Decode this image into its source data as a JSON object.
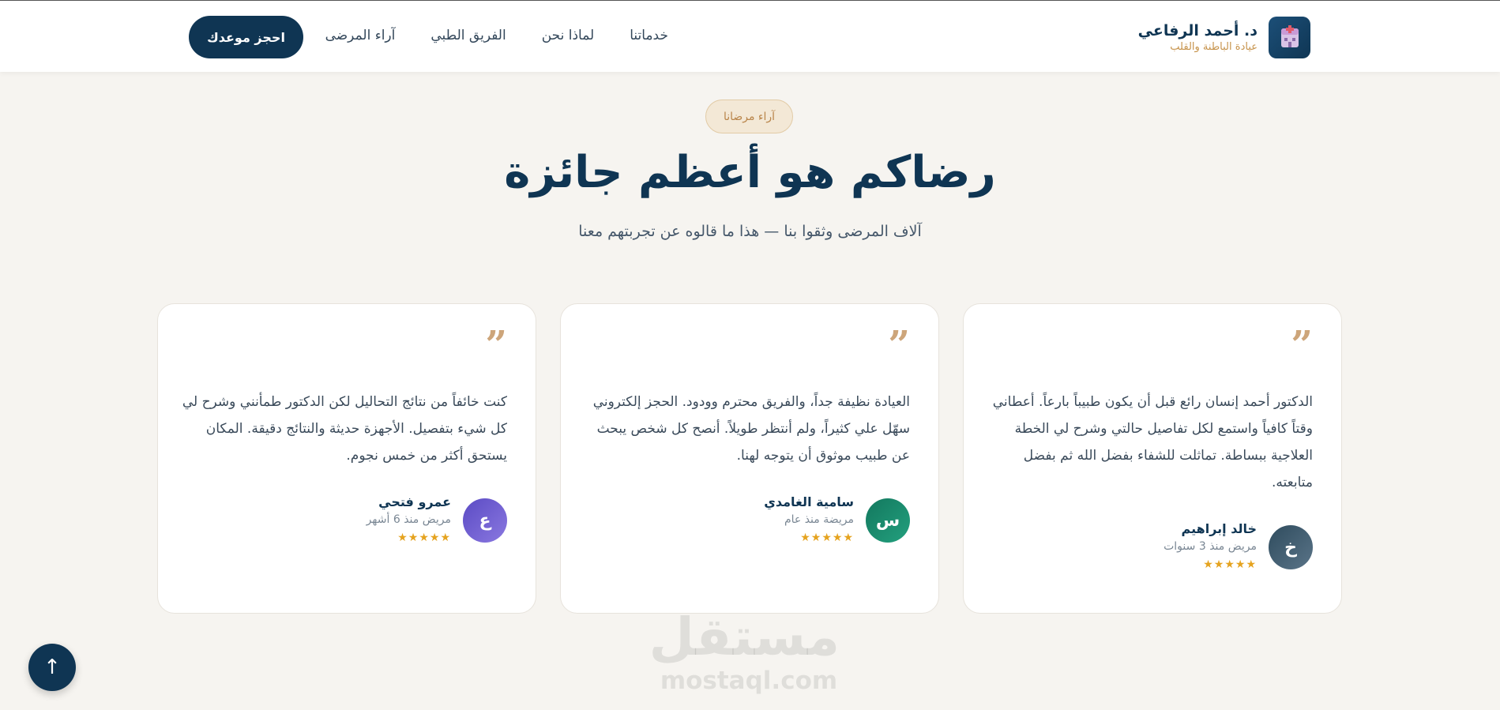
{
  "header": {
    "brand_name": "د. أحمد الرفاعي",
    "brand_subtitle": "عيادة الباطنة والقلب",
    "nav": [
      "خدماتنا",
      "لماذا نحن",
      "الفريق الطبي",
      "آراء المرضى"
    ],
    "cta_label": "احجز موعدك"
  },
  "section": {
    "badge": "آراء مرضانا",
    "title": "رضاكم هو أعظم جائزة",
    "subtitle": "آلاف المرضى وثقوا بنا — هذا ما قالوه عن تجربتهم معنا"
  },
  "testimonials": [
    {
      "quote_mark": "”",
      "text": "الدكتور أحمد إنسان رائع قبل أن يكون طبيباً بارعاً. أعطاني وقتاً كافياً واستمع لكل تفاصيل حالتي وشرح لي الخطة العلاجية ببساطة. تماثلت للشفاء بفضل الله ثم بفضل متابعته.",
      "avatar_letter": "خ",
      "name": "خالد إبراهيم",
      "meta": "مريض منذ 3 سنوات",
      "stars": "★★★★★",
      "rating": 5,
      "avatar_color": "#3e5a6c"
    },
    {
      "quote_mark": "”",
      "text": "العيادة نظيفة جداً، والفريق محترم وودود. الحجز إلكتروني سهّل علي كثيراً، ولم أنتظر طويلاً. أنصح كل شخص يبحث عن طبيب موثوق أن يتوجه لهنا.",
      "avatar_letter": "س",
      "name": "سامية الغامدي",
      "meta": "مريضة منذ عام",
      "stars": "★★★★★",
      "rating": 5,
      "avatar_color": "#1a8a6c"
    },
    {
      "quote_mark": "”",
      "text": "كنت خائفاً من نتائج التحاليل لكن الدكتور طمأنني وشرح لي كل شيء بتفصيل. الأجهزة حديثة والنتائج دقيقة. المكان يستحق أكثر من خمس نجوم.",
      "avatar_letter": "ع",
      "name": "عمرو فتحي",
      "meta": "مريض منذ 6 أشهر",
      "stars": "★★★★★",
      "rating": 5,
      "avatar_color": "#6a5acd"
    }
  ],
  "watermark": {
    "arabic": "مستقل",
    "latin": "mostaql.com"
  },
  "scroll_top": {
    "label": "↑"
  },
  "colors": {
    "primary": "#0f3553",
    "accent": "#c6924a",
    "star": "#e5a31f",
    "background": "#f6f4f0"
  }
}
